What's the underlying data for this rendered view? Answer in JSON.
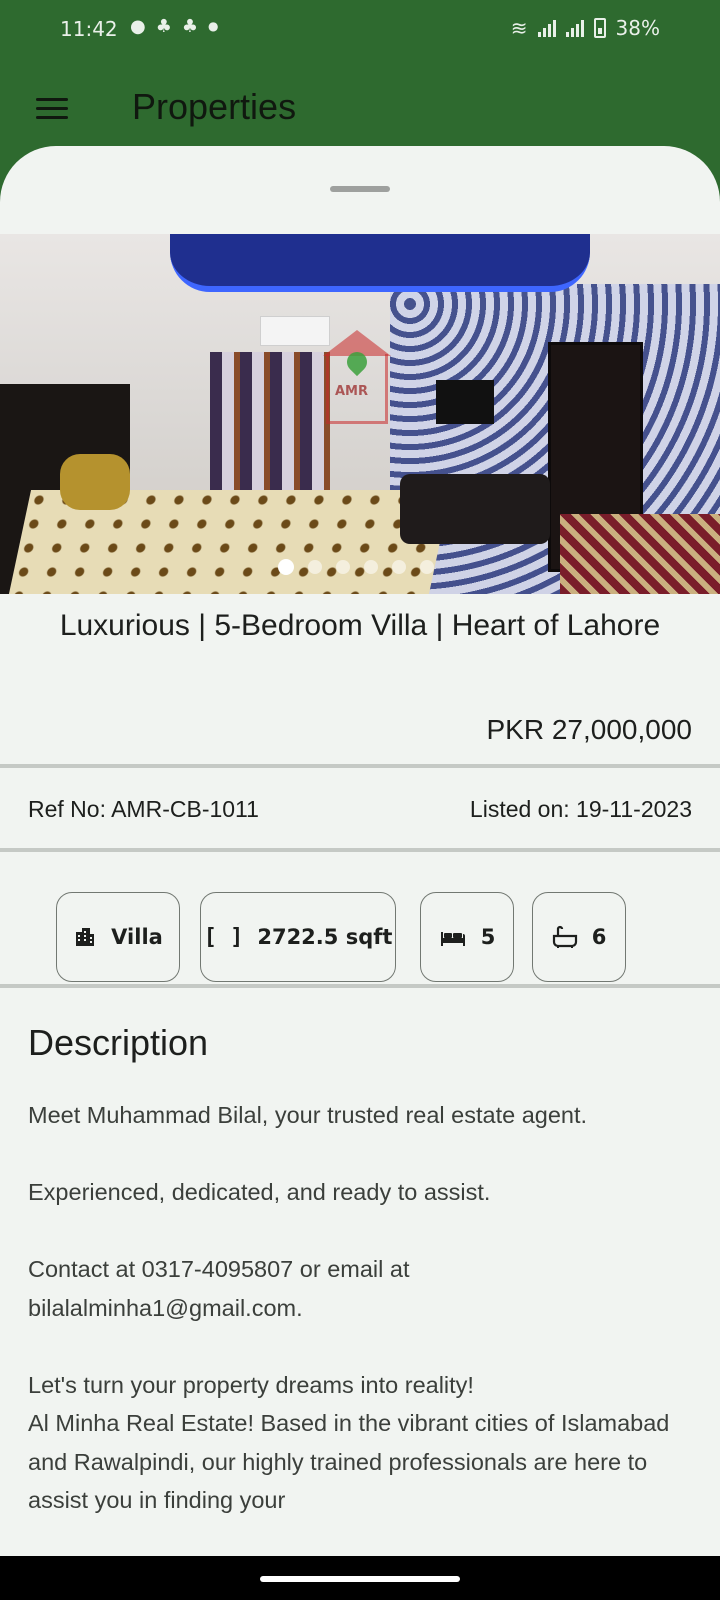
{
  "status_bar": {
    "time": "11:42",
    "battery": "38%",
    "notification_icons": [
      "chat-bubble-icon",
      "snapchat-icon",
      "snapchat-icon",
      "dot-icon"
    ]
  },
  "app_bar": {
    "title": "Properties",
    "background": "#2e6a2f"
  },
  "gallery": {
    "image_count": 6,
    "current_index": 1,
    "watermark": "AMR"
  },
  "listing": {
    "title": "Luxurious | 5-Bedroom Villa | Heart of Lahore",
    "price": "PKR 27,000,000",
    "ref": "Ref No: AMR-CB-1011",
    "listed_on": "Listed on: 19-11-2023"
  },
  "chips": [
    {
      "icon": "building-icon",
      "label": "Villa"
    },
    {
      "icon": "area-brackets-icon",
      "label": "2722.5 sqft"
    },
    {
      "icon": "bed-icon",
      "label": "5"
    },
    {
      "icon": "bathtub-icon",
      "label": "6"
    }
  ],
  "description": {
    "heading": "Description",
    "paragraphs": [
      "Meet Muhammad Bilal, your trusted real estate agent.",
      "Experienced, dedicated, and ready to assist.",
      "Contact at 0317-4095807 or email at bilalalminha1@gmail.com.",
      "Let's turn your property dreams into reality!",
      "Al Minha Real Estate! Based in the vibrant cities of Islamabad and Rawalpindi, our highly trained professionals are here to assist you in finding your"
    ]
  }
}
